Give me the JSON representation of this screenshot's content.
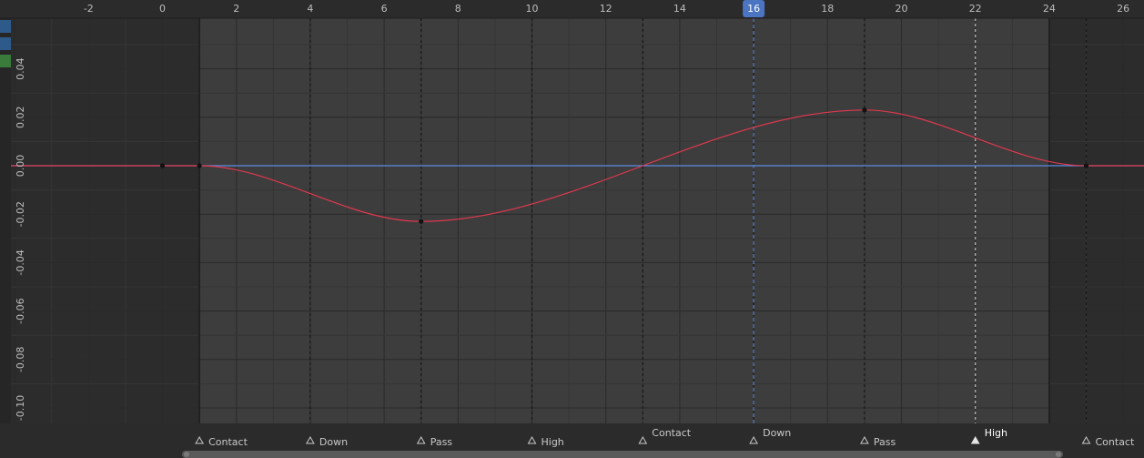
{
  "editor": {
    "name": "Graph Editor",
    "colors": {
      "background": "#303030",
      "active_range": "#3d3d3d",
      "outside_range": "#2c2c2c",
      "curve": "#e0384f",
      "playhead": "#5d8de3",
      "zero_line": "#5d8de3",
      "frame_badge": "#4b74c2"
    }
  },
  "channel_swatches": [
    "#2e5a8a",
    "#2e5a8a",
    "#3a7a3a"
  ],
  "timeline": {
    "current_frame": "16",
    "frame_ticks": [
      "-2",
      "0",
      "2",
      "4",
      "6",
      "8",
      "10",
      "12",
      "14",
      "16",
      "18",
      "20",
      "22",
      "24",
      "26"
    ],
    "scene_range": {
      "start": 1,
      "end": 24
    }
  },
  "value_axis": {
    "tick_labels": [
      "0.04",
      "0.02",
      "0.00",
      "-0.02",
      "-0.04",
      "-0.06",
      "-0.08",
      "-0.10"
    ]
  },
  "markers": [
    {
      "frame": 1,
      "label": "Contact",
      "selected": false
    },
    {
      "frame": 4,
      "label": "Down",
      "selected": false
    },
    {
      "frame": 7,
      "label": "Pass",
      "selected": false
    },
    {
      "frame": 10,
      "label": "High",
      "selected": false
    },
    {
      "frame": 13,
      "label": "Contact",
      "selected": false
    },
    {
      "frame": 16,
      "label": "Down",
      "selected": false
    },
    {
      "frame": 19,
      "label": "Pass",
      "selected": false
    },
    {
      "frame": 22,
      "label": "High",
      "selected": true
    },
    {
      "frame": 25,
      "label": "Contact",
      "selected": false
    }
  ],
  "chart_data": {
    "type": "line",
    "x_label": "",
    "y_label": "",
    "xlim": [
      -2.4,
      26.8
    ],
    "ylim": [
      -0.105,
      0.05
    ],
    "grid": true,
    "keyframes": [
      {
        "frame": 0,
        "value": 0.0
      },
      {
        "frame": 1,
        "value": 0.0
      },
      {
        "frame": 7,
        "value": -0.023
      },
      {
        "frame": 19,
        "value": 0.023
      },
      {
        "frame": 25,
        "value": 0.0
      }
    ]
  }
}
